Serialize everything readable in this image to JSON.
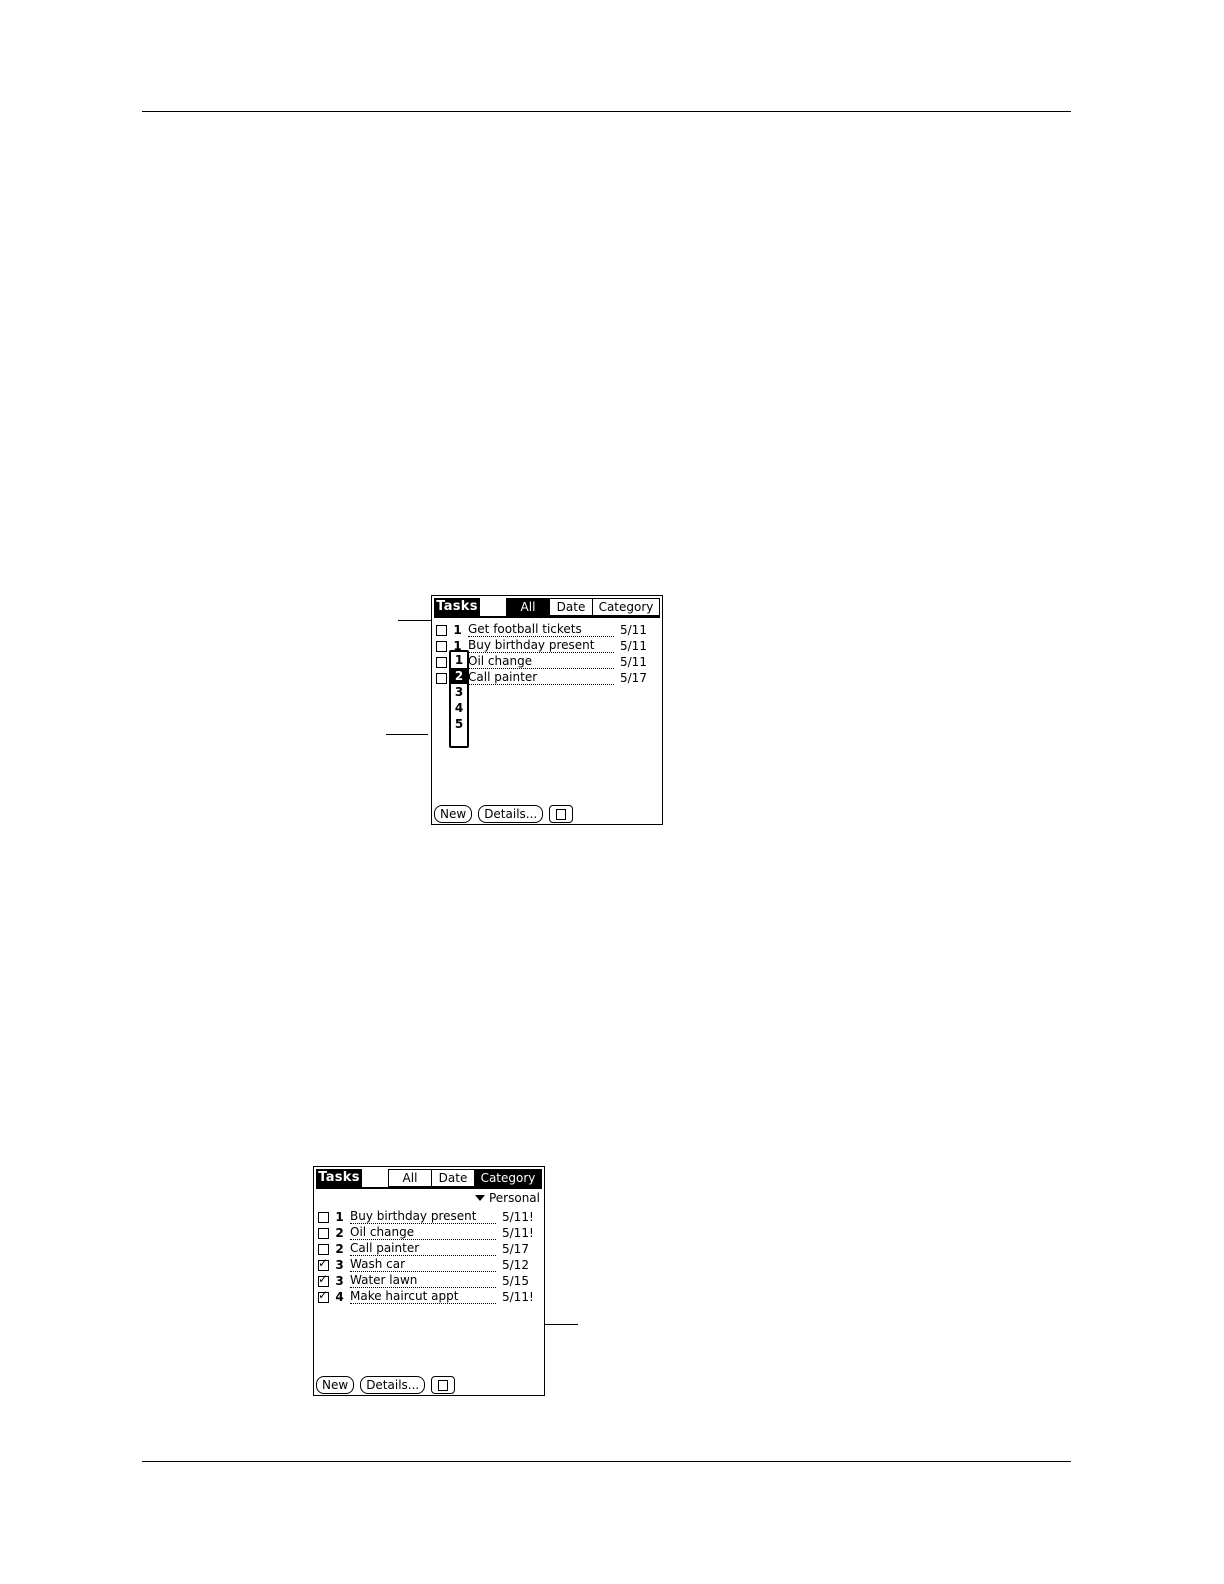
{
  "screen1": {
    "title": "Tasks",
    "tabs": {
      "all": "All",
      "date": "Date",
      "category": "Category"
    },
    "selected_tab": "all",
    "rows": [
      {
        "priority": "1",
        "description": "Get football tickets",
        "due": "5/11",
        "checked": false
      },
      {
        "priority": "1",
        "description": "Buy birthday present",
        "due": "5/11",
        "checked": false
      },
      {
        "priority": "2",
        "description": "Oil change",
        "due": "5/11",
        "checked": false
      },
      {
        "priority": "",
        "description": "Call painter",
        "due": "5/17",
        "checked": false
      }
    ],
    "priority_popup": {
      "options": [
        "1",
        "2",
        "3",
        "4",
        "5"
      ],
      "selected": "2"
    },
    "buttons": {
      "new": "New",
      "details": "Details..."
    }
  },
  "screen2": {
    "title": "Tasks",
    "tabs": {
      "all": "All",
      "date": "Date",
      "category": "Category"
    },
    "selected_tab": "category",
    "category_picker": "Personal",
    "rows": [
      {
        "priority": "1",
        "description": "Buy birthday present",
        "due": "5/11!",
        "checked": false
      },
      {
        "priority": "2",
        "description": "Oil change",
        "due": "5/11!",
        "checked": false
      },
      {
        "priority": "2",
        "description": "Call painter",
        "due": "5/17",
        "checked": false
      },
      {
        "priority": "3",
        "description": "Wash car",
        "due": "5/12",
        "checked": true
      },
      {
        "priority": "3",
        "description": "Water lawn",
        "due": "5/15",
        "checked": true
      },
      {
        "priority": "4",
        "description": "Make haircut appt",
        "due": "5/11!",
        "checked": true
      }
    ],
    "buttons": {
      "new": "New",
      "details": "Details..."
    }
  },
  "icons": {
    "note": "note-icon",
    "dropdown": "triangle-down-icon",
    "checkmark": "checkmark-icon"
  }
}
